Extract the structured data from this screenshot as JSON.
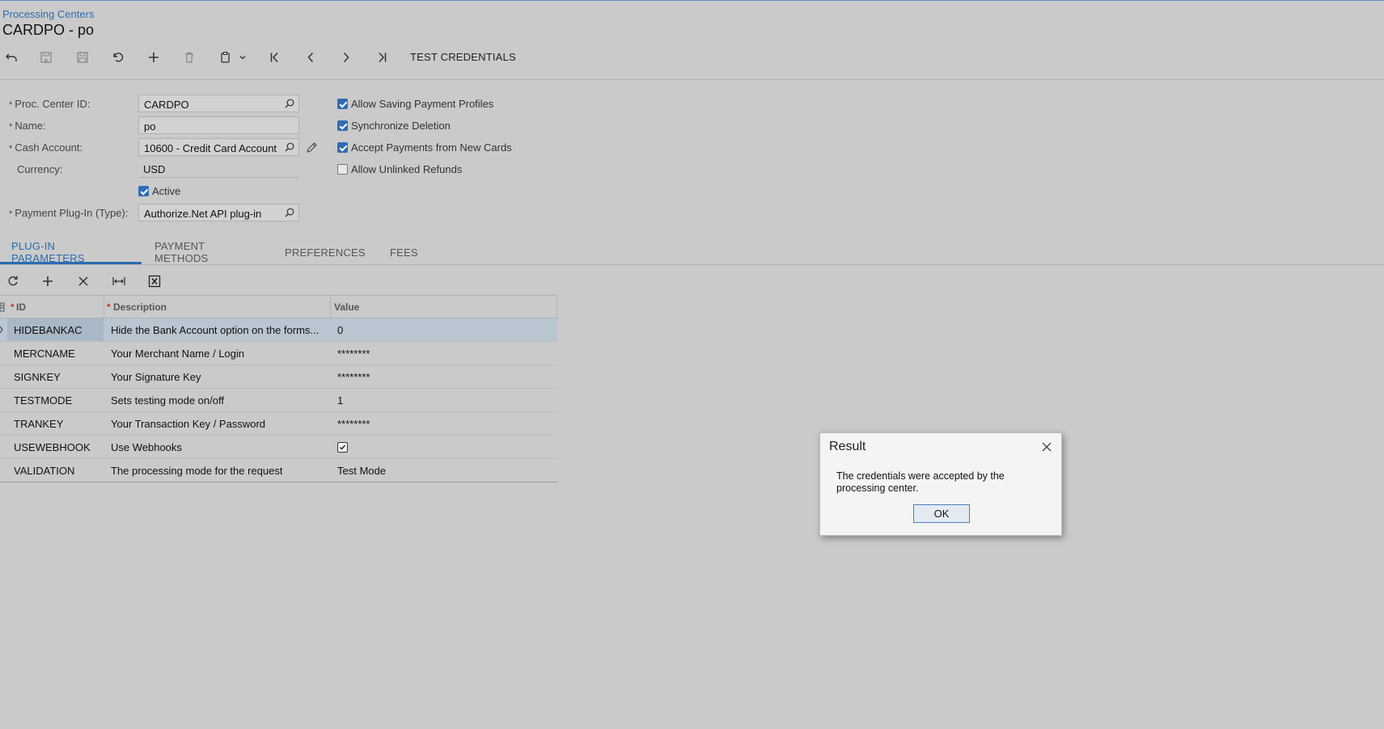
{
  "breadcrumb": "Processing Centers",
  "page_title": "CARDPO - po",
  "toolbar": {
    "icons": [
      "back-icon",
      "save-close-icon",
      "save-icon",
      "undo-icon",
      "add-icon",
      "delete-icon",
      "clipboard-icon",
      "chevron-down-icon",
      "first-record-icon",
      "previous-record-icon",
      "next-record-icon",
      "last-record-icon"
    ],
    "test_credentials": "TEST CREDENTIALS"
  },
  "form": {
    "proc_center_id": {
      "label": "Proc. Center ID:",
      "value": "CARDPO",
      "required": "*"
    },
    "name": {
      "label": "Name:",
      "value": "po",
      "required": "*"
    },
    "cash_account": {
      "label": "Cash Account:",
      "value": "10600 - Credit Card Account",
      "required": "*"
    },
    "currency": {
      "label": "Currency:",
      "value": "USD"
    },
    "active": {
      "label": "Active",
      "checked": true
    },
    "payment_plugin": {
      "label": "Payment Plug-In (Type):",
      "value": "Authorize.Net API plug-in",
      "required": "*"
    }
  },
  "options": [
    {
      "label": "Allow Saving Payment Profiles",
      "checked": true
    },
    {
      "label": "Synchronize Deletion",
      "checked": true
    },
    {
      "label": "Accept Payments from New Cards",
      "checked": true
    },
    {
      "label": "Allow Unlinked Refunds",
      "checked": false
    }
  ],
  "tabs": [
    {
      "label": "PLUG-IN PARAMETERS",
      "active": true
    },
    {
      "label": "PAYMENT METHODS",
      "active": false
    },
    {
      "label": "PREFERENCES",
      "active": false
    },
    {
      "label": "FEES",
      "active": false
    }
  ],
  "grid": {
    "toolbar_icons": [
      "refresh-icon",
      "add-row-icon",
      "delete-row-icon",
      "fit-columns-icon",
      "export-excel-icon"
    ],
    "columns": [
      {
        "label": "ID",
        "required": "*"
      },
      {
        "label": "Description",
        "required": "*"
      },
      {
        "label": "Value",
        "required": ""
      }
    ],
    "rows": [
      {
        "id": "HIDEBANKAC",
        "description": "Hide the Bank Account option on the forms...",
        "value": "0",
        "selected": true
      },
      {
        "id": "MERCNAME",
        "description": "Your Merchant Name / Login",
        "value": "********"
      },
      {
        "id": "SIGNKEY",
        "description": "Your Signature Key",
        "value": "********"
      },
      {
        "id": "TESTMODE",
        "description": "Sets testing mode on/off",
        "value": "1"
      },
      {
        "id": "TRANKEY",
        "description": "Your Transaction Key / Password",
        "value": "********"
      },
      {
        "id": "USEWEBHOOK",
        "description": "Use Webhooks",
        "value_checkbox": true
      },
      {
        "id": "VALIDATION",
        "description": "The processing mode for the request",
        "value": "Test Mode"
      }
    ]
  },
  "dialog": {
    "title": "Result",
    "message": "The credentials were accepted by the processing center.",
    "ok_label": "OK"
  },
  "colors": {
    "accent": "#2b6cb0",
    "background": "#cacaca",
    "checkbox": "#2f6db5"
  }
}
